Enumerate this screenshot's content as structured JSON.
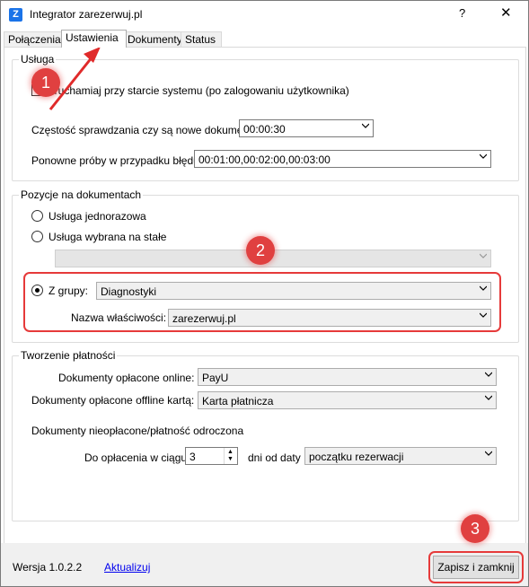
{
  "window": {
    "app_icon_letter": "Z",
    "title": "Integrator zarezerwuj.pl",
    "help_label": "?",
    "close_label": "✕"
  },
  "tabs": [
    {
      "label": "Połączenia"
    },
    {
      "label": "Ustawienia"
    },
    {
      "label": "Dokumenty"
    },
    {
      "label": "Status"
    }
  ],
  "active_tab": "Ustawienia",
  "usluga": {
    "legend": "Usługa",
    "autostart_label": "Uruchamiaj przy starcie systemu (po zalogowaniu użytkownika)",
    "autostart_checked": true,
    "frequency_label": "Częstość sprawdzania czy są nowe dokumenty",
    "frequency_value": "00:00:30",
    "retry_label": "Ponowne próby w przypadku błędu:",
    "retry_value": "00:01:00,00:02:00,00:03:00"
  },
  "pozycje": {
    "legend": "Pozycje na dokumentach",
    "option_jednorazowa": "Usługa jednorazowa",
    "option_stala": "Usługa wybrana na stałe",
    "option_grupy": "Z grupy:",
    "selected_option": "Z grupy:",
    "stala_value": "",
    "group_value": "Diagnostyki",
    "property_label": "Nazwa właściwości:",
    "property_value": "zarezerwuj.pl"
  },
  "platnosci": {
    "legend": "Tworzenie płatności",
    "online_label": "Dokumenty opłacone online:",
    "online_value": "PayU",
    "offline_label": "Dokumenty opłacone offline kartą:",
    "offline_value": "Karta płatnicza",
    "unpaid_heading": "Dokumenty nieopłacone/płatność odroczona",
    "due_label": "Do opłacenia w ciągu",
    "due_value": "3",
    "days_from_label": "dni od daty",
    "date_ref_value": "początku rezerwacji"
  },
  "footer": {
    "version": "Wersja 1.0.2.2",
    "update_link": "Aktualizuj",
    "save_button": "Zapisz i zamknij"
  },
  "annotations": [
    {
      "number": "1"
    },
    {
      "number": "2"
    },
    {
      "number": "3"
    }
  ],
  "colors": {
    "annotation_red": "#e04040",
    "link_blue": "#0000ee",
    "app_icon_blue": "#1a73e8"
  }
}
